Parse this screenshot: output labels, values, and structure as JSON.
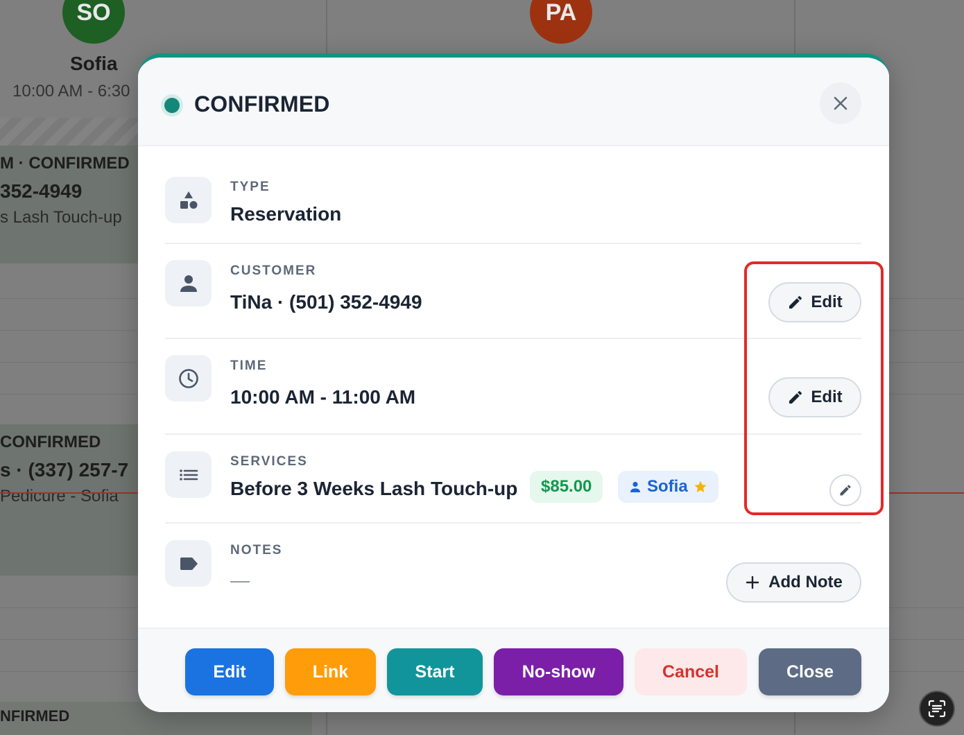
{
  "background": {
    "staff": [
      {
        "initials": "SO",
        "name": "Sofia",
        "hours": "10:00 AM - 6:30"
      },
      {
        "initials": "PA"
      }
    ],
    "appointments": [
      {
        "status": "M · CONFIRMED",
        "phone": "352-4949",
        "service": "s Lash Touch-up"
      },
      {
        "status": "CONFIRMED",
        "phone": "s · (337) 257-7",
        "service": "Pedicure - Sofia"
      },
      {
        "status": "NFIRMED"
      }
    ]
  },
  "modal": {
    "status": "CONFIRMED",
    "status_color": "#12877a",
    "close_icon": "close-icon",
    "type": {
      "label": "TYPE",
      "value": "Reservation",
      "icon": "shapes-icon"
    },
    "customer": {
      "label": "CUSTOMER",
      "value": "TiNa · (501) 352-4949",
      "icon": "person-icon",
      "edit_label": "Edit"
    },
    "time": {
      "label": "TIME",
      "value": "10:00 AM - 11:00 AM",
      "icon": "clock-icon",
      "edit_label": "Edit"
    },
    "services": {
      "label": "SERVICES",
      "icon": "list-icon",
      "name": "Before 3 Weeks Lash Touch-up",
      "price": "$85.00",
      "staff": "Sofia",
      "staff_icon": "person-icon",
      "preferred_icon": "star-icon"
    },
    "notes": {
      "label": "NOTES",
      "value": "—",
      "icon": "tag-icon",
      "add_label": "Add Note"
    },
    "actions": [
      {
        "label": "Edit",
        "color": "#1a73e0"
      },
      {
        "label": "Link",
        "color": "#ff9c0a"
      },
      {
        "label": "Start",
        "color": "#11959a"
      },
      {
        "label": "No-show",
        "color": "#7b1fa9"
      },
      {
        "label": "Cancel",
        "color": "#fde9e9",
        "text_color": "#d6322e"
      },
      {
        "label": "Close",
        "color": "#5d6c84"
      }
    ]
  }
}
